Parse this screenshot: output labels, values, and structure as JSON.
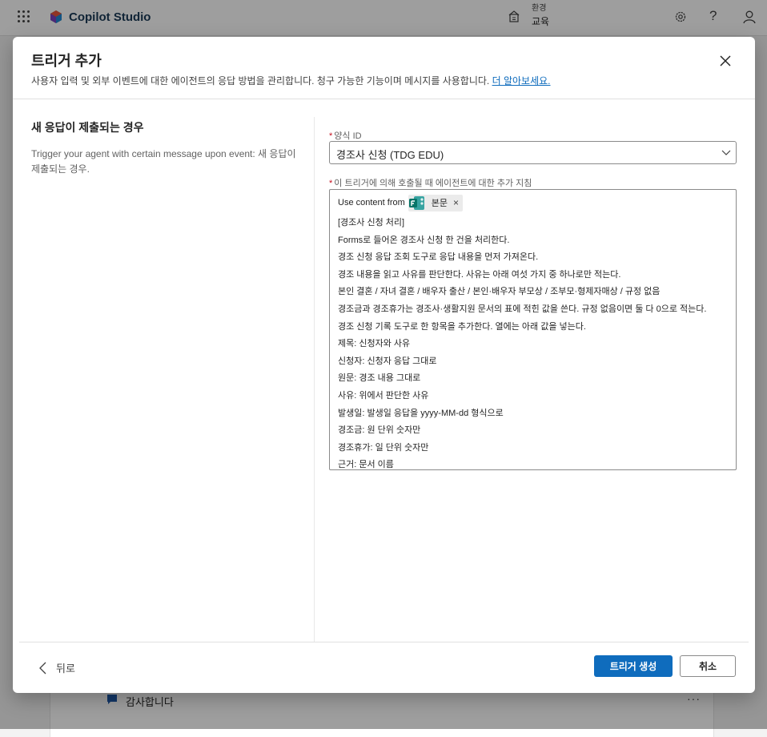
{
  "app": {
    "name": "Copilot Studio"
  },
  "header": {
    "env_label": "환경",
    "env_value": "교육"
  },
  "background": {
    "item_label": "감사합니다",
    "more": "···"
  },
  "dialog": {
    "title": "트리거 추가",
    "subtitle": "사용자 입력 및 외부 이벤트에 대한 에이전트의 응답 방법을 관리합니다. 청구 가능한 기능이며 메시지를 사용합니다.",
    "learn_more": "더 알아보세요.",
    "left": {
      "title": "새 응답이 제출되는 경우",
      "description": "Trigger your agent with certain message upon event: 새 응답이 제출되는 경우."
    },
    "form_id": {
      "required": "*",
      "label": "양식 ID",
      "value": "경조사 신청 (TDG EDU)"
    },
    "instructions": {
      "required": "*",
      "label": "이 트리거에 의해 호출될 때 에이전트에 대한 추가 지침",
      "prefix": "Use content from",
      "token_label": "본문",
      "token_remove": "×",
      "lines": [
        "[경조사 신청 처리]",
        "Forms로 들어온 경조사 신청 한 건을 처리한다.",
        "경조 신청 응답 조회 도구로 응답 내용을 먼저 가져온다.",
        "경조 내용을 읽고 사유를 판단한다. 사유는 아래 여섯 가지 중 하나로만 적는다.",
        "본인 결혼 / 자녀 결혼 / 배우자 출산 / 본인·배우자 부모상 / 조부모·형제자매상 / 규정 없음",
        "경조금과 경조휴가는 경조사·생활지원 문서의 표에 적힌 값을 쓴다. 규정 없음이면 둘 다 0으로 적는다.",
        "경조 신청 기록 도구로 한 항목을 추가한다. 열에는 아래 값을 넣는다.",
        "제목: 신청자와 사유",
        "신청자: 신청자 응답 그대로",
        "원문: 경조 내용 그대로",
        "사유: 위에서 판단한 사유",
        "발생일: 발생일 응답을 yyyy-MM-dd 형식으로",
        "경조금: 원 단위 숫자만",
        "경조휴가: 일 단위 숫자만",
        "근거: 문서 이름"
      ]
    },
    "footer": {
      "back": "뒤로",
      "create": "트리거 생성",
      "cancel": "취소"
    }
  },
  "colors": {
    "accent": "#0f6cbd",
    "required": "#c50f1f"
  }
}
